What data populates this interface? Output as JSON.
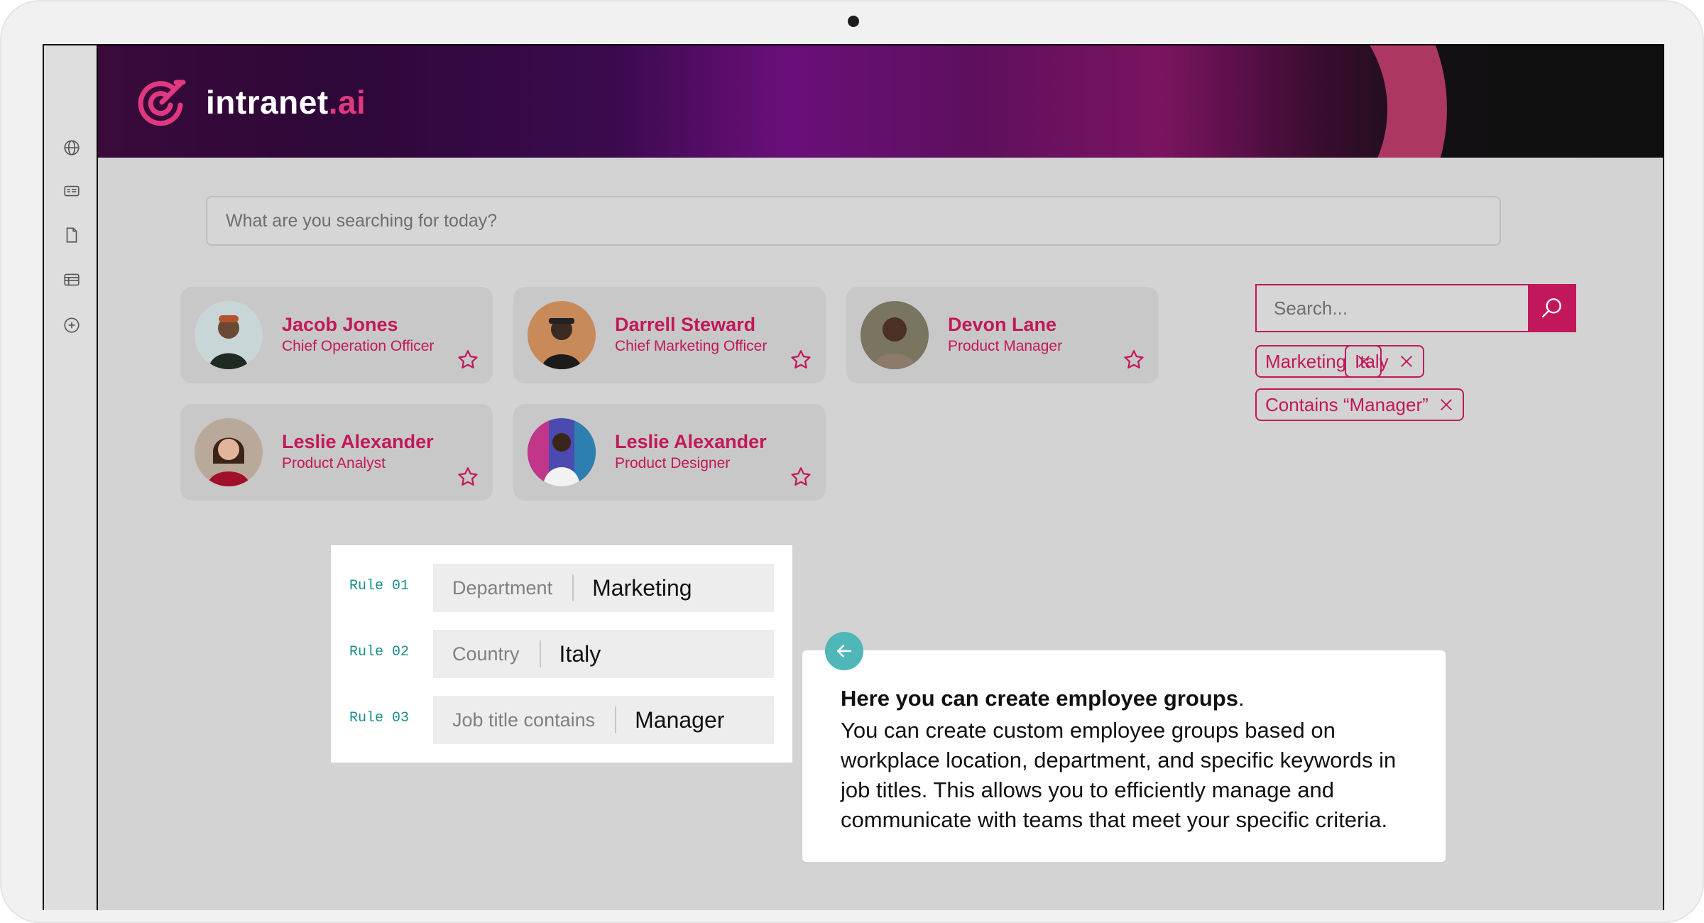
{
  "brand": {
    "name_main": "intranet",
    "name_accent": ".ai",
    "accent_color": "#e0397f",
    "primary_color": "#c2185b"
  },
  "sidebar": {
    "items": [
      {
        "icon": "globe-icon"
      },
      {
        "icon": "news-icon"
      },
      {
        "icon": "document-icon"
      },
      {
        "icon": "table-icon"
      },
      {
        "icon": "add-circle-icon"
      }
    ]
  },
  "search": {
    "placeholder": "What are you searching for today?"
  },
  "people": [
    {
      "name": "Jacob Jones",
      "role": "Chief Operation Officer"
    },
    {
      "name": "Darrell Steward",
      "role": "Chief Marketing Officer"
    },
    {
      "name": "Devon Lane",
      "role": "Product Manager"
    },
    {
      "name": "Leslie Alexander",
      "role": "Product Analyst"
    },
    {
      "name": "Leslie Alexander",
      "role": "Product Designer"
    }
  ],
  "filter": {
    "placeholder": "Search...",
    "chips": [
      "Marketing",
      "Italy",
      "Contains “Manager”"
    ]
  },
  "rules": [
    {
      "label": "Rule 01",
      "key": "Department",
      "value": "Marketing"
    },
    {
      "label": "Rule 02",
      "key": "Country",
      "value": "Italy"
    },
    {
      "label": "Rule 03",
      "key": "Job title contains",
      "value": "Manager"
    }
  ],
  "info": {
    "title_bold": "Here you can create employee groups",
    "title_rest": ".",
    "body": "You can create custom employee groups based on workplace location, department, and specific keywords in job titles. This allows you to efficiently manage and communicate with teams that meet your specific criteria."
  }
}
